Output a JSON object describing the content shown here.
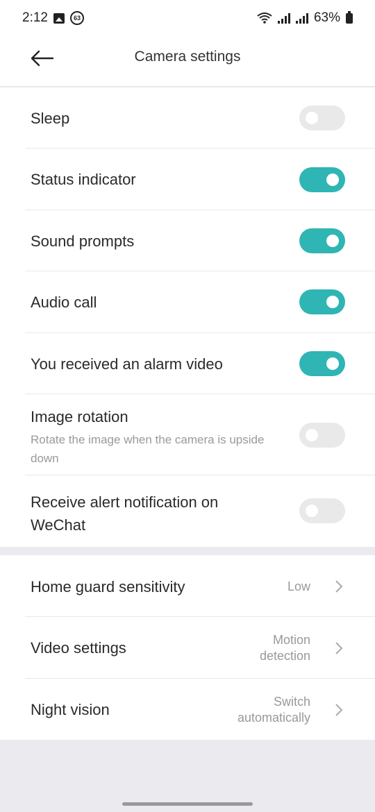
{
  "status_bar": {
    "time": "2:12",
    "badge": "63",
    "battery": "63%"
  },
  "header": {
    "title": "Camera settings"
  },
  "toggles": [
    {
      "title": "Sleep",
      "subtitle": "",
      "on": false
    },
    {
      "title": "Status indicator",
      "subtitle": "",
      "on": true
    },
    {
      "title": "Sound prompts",
      "subtitle": "",
      "on": true
    },
    {
      "title": "Audio call",
      "subtitle": "",
      "on": true
    },
    {
      "title": "You received an alarm video",
      "subtitle": "",
      "on": true
    },
    {
      "title": "Image rotation",
      "subtitle": "Rotate the image when the camera is upside down",
      "on": false
    },
    {
      "title": "Receive alert notification on WeChat",
      "subtitle": "",
      "on": false
    }
  ],
  "nav_rows": [
    {
      "title": "Home guard sensitivity",
      "value": "Low"
    },
    {
      "title": "Video settings",
      "value_line1": "Motion",
      "value_line2": "detection"
    },
    {
      "title": "Night vision",
      "value_line1": "Switch",
      "value_line2": "automatically"
    }
  ],
  "colors": {
    "accent": "#2fb5b4",
    "toggle_off": "#e9e9e9",
    "background": "#ebebef"
  }
}
